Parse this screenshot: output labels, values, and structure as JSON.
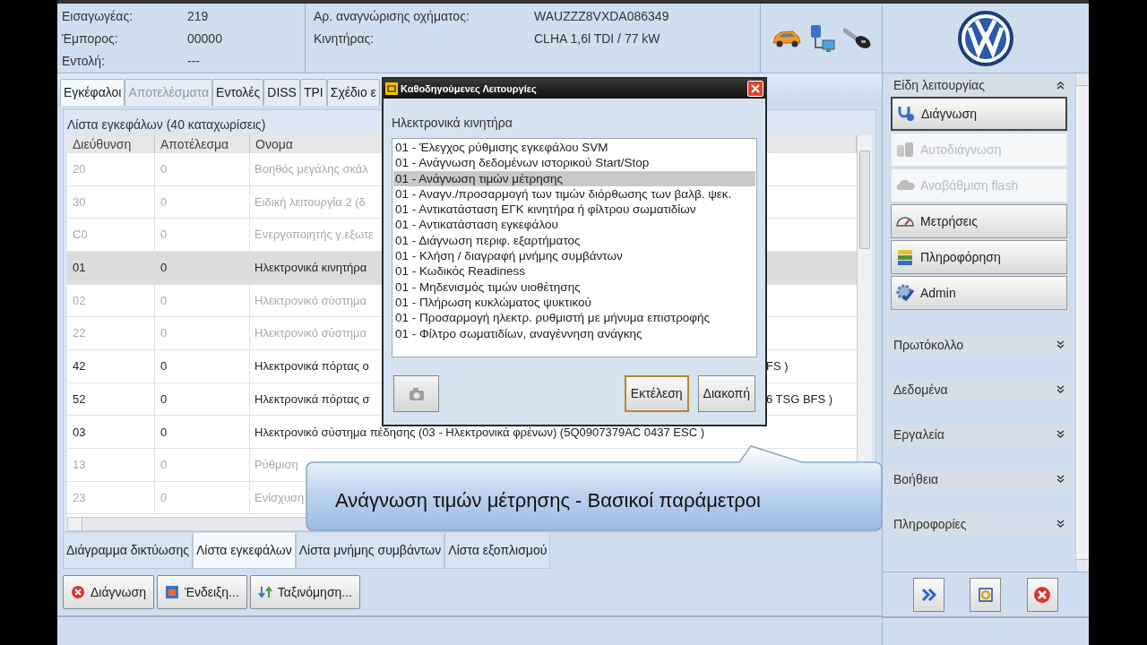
{
  "header": {
    "fields": [
      {
        "label": "Εισαγωγέας:",
        "value": "219"
      },
      {
        "label": "Έμπορος:",
        "value": "00000"
      },
      {
        "label": "Εντολή:",
        "value": "---"
      }
    ],
    "vehicle": [
      {
        "label": "Αρ. αναγνώρισης οχήματος:",
        "value": "WAUZZZ8VXDA086349"
      },
      {
        "label": "Κινητήρας:",
        "value": "CLHA 1,6l TDI / 77 kW"
      }
    ]
  },
  "tabs": [
    {
      "label": "Εγκέφαλοι",
      "selected": true,
      "disabled": false
    },
    {
      "label": "Αποτελέσματα",
      "selected": false,
      "disabled": true
    },
    {
      "label": "Εντολές",
      "selected": false,
      "disabled": false
    },
    {
      "label": "DISS",
      "selected": false,
      "disabled": false
    },
    {
      "label": "TPI",
      "selected": false,
      "disabled": false
    },
    {
      "label": "Σχέδιο ε",
      "selected": false,
      "disabled": false
    }
  ],
  "table": {
    "title": "Λίστα εγκεφάλων (40 καταχωρίσεις)",
    "columns": [
      "Διεύθυνση",
      "Αποτέλεσμα",
      "Ονομα"
    ],
    "rows": [
      {
        "address": "20",
        "result": "0",
        "name": "Βοηθός μεγάλης σκάλ",
        "disabled": true,
        "selected": false
      },
      {
        "address": "30",
        "result": "0",
        "name": "Ειδική λειτουργία 2 (δ",
        "disabled": true,
        "selected": false
      },
      {
        "address": "C0",
        "result": "0",
        "name": "Ενεργοποιητής γ.εξωτε",
        "disabled": true,
        "selected": false
      },
      {
        "address": "01",
        "result": "0",
        "name": "Ηλεκτρονικά κινητήρα",
        "disabled": false,
        "selected": true
      },
      {
        "address": "02",
        "result": "0",
        "name": "Ηλεκτρονικό σύστημα",
        "disabled": true,
        "selected": false
      },
      {
        "address": "22",
        "result": "0",
        "name": "Ηλεκτρονικό σύστημα",
        "disabled": true,
        "selected": false
      },
      {
        "address": "42",
        "result": "0",
        "name": "Ηλεκτρονικά πόρτας ο",
        "tail": "FS )",
        "disabled": false,
        "selected": false
      },
      {
        "address": "52",
        "result": "0",
        "name": "Ηλεκτρονικά πόρτας σ",
        "tail": "6 TSG BFS )",
        "disabled": false,
        "selected": false
      },
      {
        "address": "03",
        "result": "0",
        "name": "Ηλεκτρονικό σύστημα πέδησης (03 - Ηλεκτρονικά φρένων) (5Q0907379AC 0437 ESC )",
        "disabled": false,
        "selected": false
      },
      {
        "address": "13",
        "result": "0",
        "name": "Ρύθμιση",
        "disabled": true,
        "selected": false
      },
      {
        "address": "23",
        "result": "0",
        "name": "Ενίσχυση",
        "disabled": true,
        "selected": false
      }
    ]
  },
  "bottom_tabs": [
    {
      "label": "Διάγραμμα δικτύωσης",
      "selected": false
    },
    {
      "label": "Λίστα εγκεφάλων",
      "selected": true
    },
    {
      "label": "Λίστα μνήμης συμβάντων",
      "selected": false
    },
    {
      "label": "Λίστα εξοπλισμού",
      "selected": false
    }
  ],
  "toolbar": [
    "Διάγνωση",
    "Ένδειξη...",
    "Ταξινόμηση..."
  ],
  "sidebar": [
    {
      "title": "Είδη λειτουργίας",
      "expanded": true,
      "items": [
        {
          "label": "Διάγνωση",
          "disabled": false,
          "selected": true
        },
        {
          "label": "Αυτοδιάγνωση",
          "disabled": true,
          "selected": false
        },
        {
          "label": "Αναβάθμιση flash",
          "disabled": true,
          "selected": false
        },
        {
          "label": "Μετρήσεις",
          "disabled": false,
          "selected": false
        },
        {
          "label": "Πληροφόρηση",
          "disabled": false,
          "selected": false
        },
        {
          "label": "Admin",
          "disabled": false,
          "selected": false
        }
      ]
    },
    {
      "title": "Πρωτόκολλο",
      "expanded": false
    },
    {
      "title": "Δεδομένα",
      "expanded": false
    },
    {
      "title": "Εργαλεία",
      "expanded": false
    },
    {
      "title": "Βοήθεια",
      "expanded": false
    },
    {
      "title": "Πληροφορίες",
      "expanded": false
    }
  ],
  "dialog": {
    "title": "Καθοδηγούμενες Λειτουργίες",
    "label": "Ηλεκτρονικά κινητήρα",
    "items": [
      {
        "label": "01 - Έλεγχος ρύθμισης εγκεφάλου SVM",
        "selected": false
      },
      {
        "label": "01 - Ανάγνωση δεδομένων ιστορικού Start/Stop",
        "selected": false
      },
      {
        "label": "01 - Ανάγνωση τιμών μέτρησης",
        "selected": true
      },
      {
        "label": "01 - Αναγν./προσαρμογή των τιμών διόρθωσης των βαλβ. ψεκ.",
        "selected": false
      },
      {
        "label": "01 - Αντικατάσταση ΕΓΚ κινητήρα ή φίλτρου σωματιδίων",
        "selected": false
      },
      {
        "label": "01 - Αντικατάσταση εγκεφάλου",
        "selected": false
      },
      {
        "label": "01 - Διάγνωση περιφ. εξαρτήματος",
        "selected": false
      },
      {
        "label": "01 - Κλήση / διαγραφή μνήμης συμβάντων",
        "selected": false
      },
      {
        "label": "01 - Κωδικός Readiness",
        "selected": false
      },
      {
        "label": "01 - Μηδενισμός τιμών υιοθέτησης",
        "selected": false
      },
      {
        "label": "01 - Πλήρωση κυκλώματος ψυκτικού",
        "selected": false
      },
      {
        "label": "01 - Προσαρμογή ηλεκτρ. ρυθμιστή με μήνυμα επιστροφής",
        "selected": false
      },
      {
        "label": "01 - Φίλτρο σωματιδίων, αναγέννηση ανάγκης",
        "selected": false
      }
    ],
    "buttons": [
      {
        "label": "Εκτέλεση",
        "focused": true
      },
      {
        "label": "Διακοπή",
        "focused": false
      }
    ]
  },
  "callout": "Ανάγνωση τιμών μέτρησης - Βασικοί παράμετροι"
}
